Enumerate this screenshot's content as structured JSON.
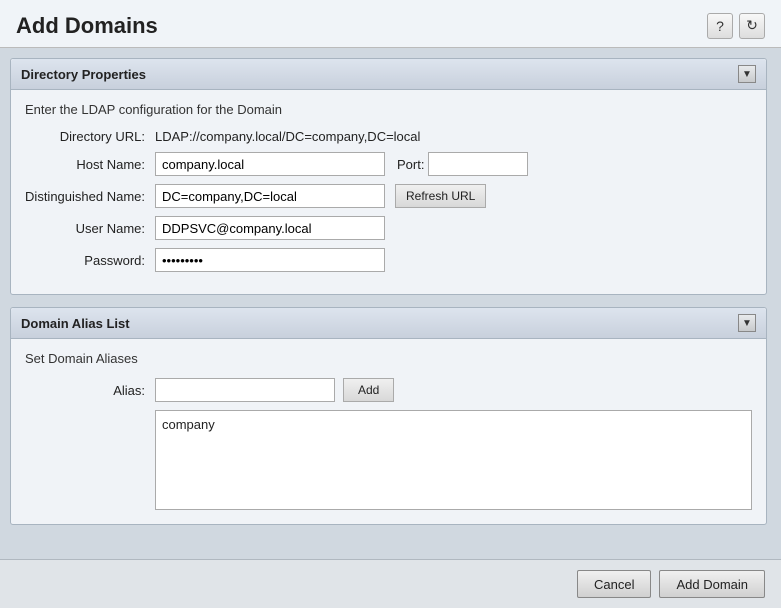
{
  "header": {
    "title": "Add Domains",
    "help_icon": "?",
    "refresh_icon": "↻"
  },
  "directory_panel": {
    "title": "Directory Properties",
    "collapse_icon": "▼",
    "description": "Enter the LDAP configuration for the Domain",
    "fields": {
      "directory_url_label": "Directory URL:",
      "directory_url_value": "LDAP://company.local/DC=company,DC=local",
      "hostname_label": "Host Name:",
      "hostname_value": "company.local",
      "port_label": "Port:",
      "port_value": "",
      "port_placeholder": "",
      "dn_label": "Distinguished Name:",
      "dn_value": "DC=company,DC=local",
      "refresh_url_label": "Refresh URL",
      "username_label": "User Name:",
      "username_value": "DDPSVC@company.local",
      "password_label": "Password:",
      "password_value": "••••••••"
    }
  },
  "alias_panel": {
    "title": "Domain Alias List",
    "collapse_icon": "▼",
    "description": "Set Domain Aliases",
    "alias_label": "Alias:",
    "alias_placeholder": "",
    "add_button_label": "Add",
    "alias_list": [
      "company"
    ]
  },
  "footer": {
    "cancel_label": "Cancel",
    "add_domain_label": "Add Domain"
  }
}
